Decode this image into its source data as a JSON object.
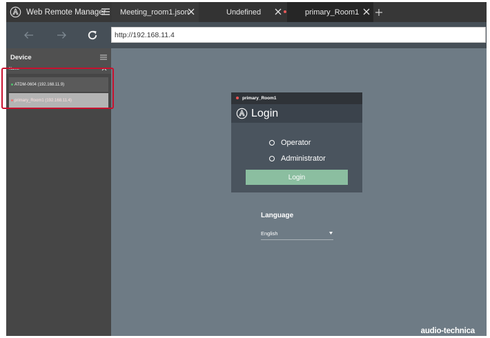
{
  "app": {
    "title": "Web Remote Manager",
    "brand_footer": "audio-technica"
  },
  "tabs": [
    {
      "label": "Meeting_room1.json",
      "has_close": true,
      "active": false,
      "unsaved": false
    },
    {
      "label": "Undefined",
      "has_close": true,
      "active": false,
      "unsaved": true
    },
    {
      "label": "primary_Room1",
      "has_close": true,
      "active": true,
      "unsaved": true
    }
  ],
  "icons": {
    "brand": "audio-technica-logo-icon",
    "menu": "hamburger-menu-icon",
    "close": "close-icon",
    "new_tab": "plus-icon",
    "back": "arrow-left-icon",
    "forward": "arrow-right-icon",
    "reload": "reload-icon",
    "sort": "chevron-up-icon",
    "dropdown": "caret-down-icon"
  },
  "address_bar": {
    "url": "http://192.168.11.4"
  },
  "sidebar": {
    "title": "Device",
    "column_header": "Name",
    "devices": [
      {
        "label": "ATDM-0604 (192.168.11.9)",
        "status_color": "#4fc26d",
        "selected": false
      },
      {
        "label": "primary_Room1 (192.168.11.4)",
        "status_color": "#f07070",
        "selected": true
      }
    ]
  },
  "login": {
    "device_name": "primary_Room1",
    "title": "Login",
    "options": [
      "Operator",
      "Administrator"
    ],
    "button_label": "Login"
  },
  "language": {
    "label": "Language",
    "selected": "English"
  },
  "colors": {
    "accent_button": "#8bbea0",
    "highlight_border": "#c8102e",
    "status_connected": "#4fc26d",
    "status_unsaved": "#e65a5a"
  }
}
